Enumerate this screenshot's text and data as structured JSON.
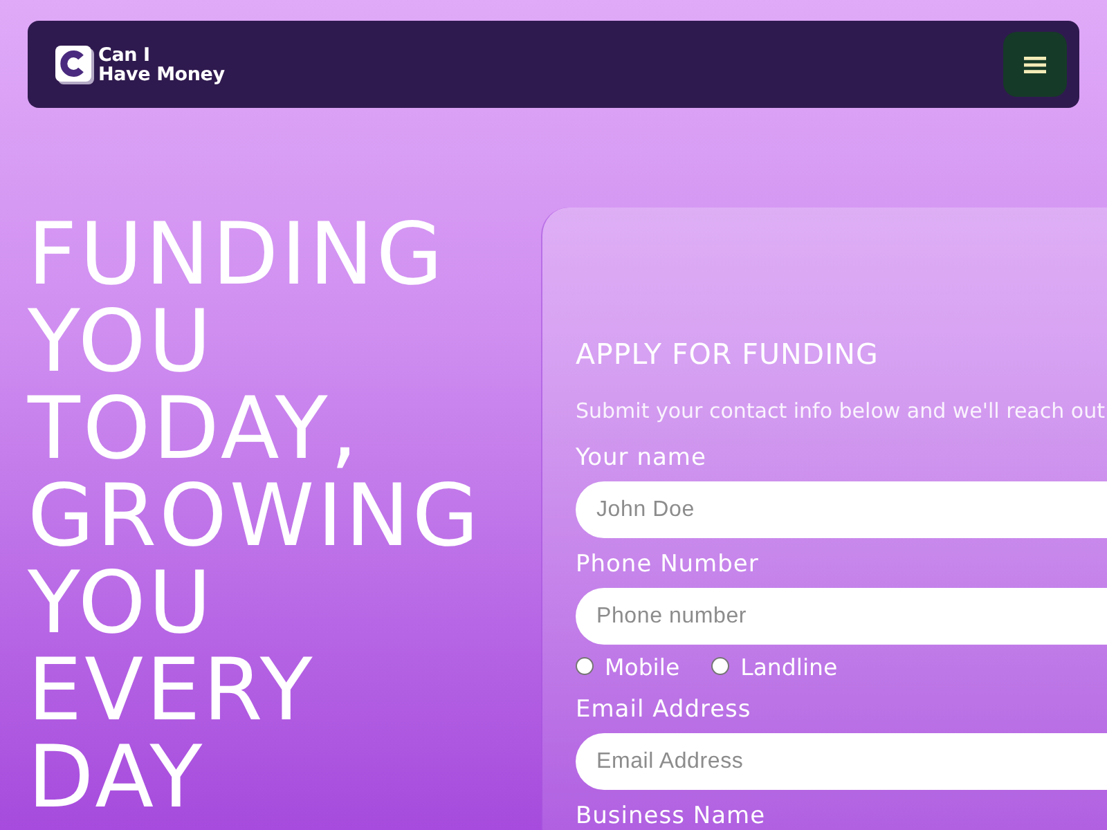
{
  "header": {
    "brand_lines": [
      "Can I",
      "Have Money"
    ]
  },
  "hero": {
    "headline": "FUNDING YOU TODAY, GROWING YOU EVERY DAY"
  },
  "form": {
    "title": "APPLY FOR FUNDING",
    "subtitle": "Submit your contact info below and we'll reach out",
    "fields": [
      {
        "kind": "input",
        "label": "Your name",
        "placeholder": "John Doe"
      },
      {
        "kind": "input",
        "label": "Phone Number",
        "placeholder": "Phone number"
      },
      {
        "kind": "radio_group",
        "options": [
          {
            "label": "Mobile",
            "selected": false
          },
          {
            "label": "Landline",
            "selected": false
          }
        ]
      },
      {
        "kind": "input",
        "label": "Email Address",
        "placeholder": "Email Address"
      },
      {
        "kind": "input",
        "label": "Business Name"
      }
    ]
  }
}
